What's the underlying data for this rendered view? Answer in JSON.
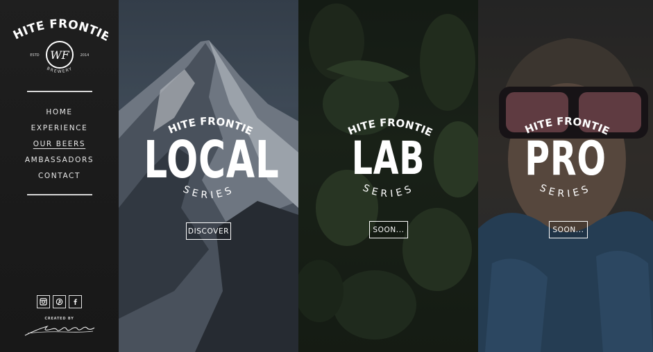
{
  "sidebar": {
    "logo": {
      "name": "WHITE FRONTIER",
      "estd": "ESTD",
      "year": "2014",
      "monogram": "WF",
      "sub": "BREWERY"
    },
    "nav": [
      {
        "label": "HOME",
        "active": false
      },
      {
        "label": "EXPERIENCE",
        "active": false
      },
      {
        "label": "OUR BEERS",
        "active": true
      },
      {
        "label": "AMBASSADORS",
        "active": false
      },
      {
        "label": "CONTACT",
        "active": false
      }
    ],
    "social": [
      "instagram-icon",
      "pinterest-icon",
      "facebook-icon"
    ],
    "credit_label": "CREATED BY",
    "credit_signature": "Mc Arnolds"
  },
  "panels": [
    {
      "brand": "WHITE FRONTIER",
      "title": "LOCAL",
      "series": "SERIES",
      "button": "DISCOVER"
    },
    {
      "brand": "WHITE FRONTIER",
      "title": "LAB",
      "series": "SERIES",
      "button": "SOON..."
    },
    {
      "brand": "WHITE FRONTIER",
      "title": "PRO",
      "series": "SERIES",
      "button": "SOON..."
    }
  ]
}
